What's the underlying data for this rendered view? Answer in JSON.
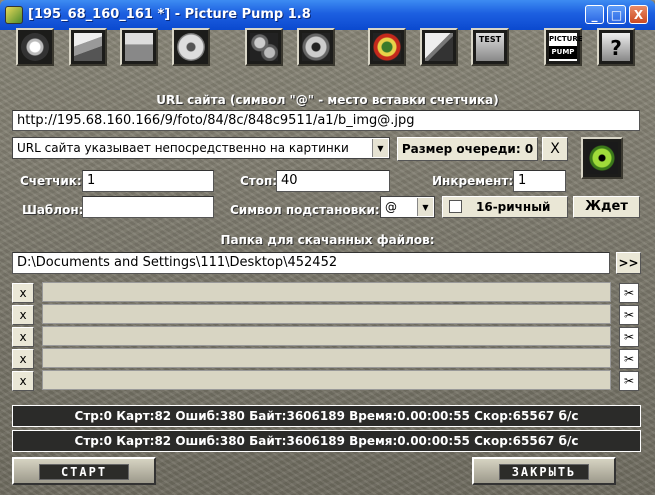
{
  "window": {
    "title": "[195_68_160_161 *] - Picture Pump 1.8"
  },
  "titlebar": {
    "minimize": "_",
    "maximize": "□",
    "close": "X"
  },
  "toolbar": {
    "test_label": "TEST",
    "picture_label": "PICTURE",
    "pump_label": "PUMP",
    "help_label": "?"
  },
  "url": {
    "label": "URL сайта (символ \"@\" - место вставки счетчика)",
    "value": "http://195.68.160.166/9/foto/84/8c/848c9511/a1/b_img@.jpg",
    "mode": "URL сайта указывает непосредственно на картинки",
    "queue_size": "Размер очереди: 0",
    "clear": "X"
  },
  "counter": {
    "counter_label": "Счетчик:",
    "counter_value": "1",
    "stop_label": "Стоп:",
    "stop_value": "40",
    "increment_label": "Инкремент:",
    "increment_value": "1",
    "template_label": "Шаблон:",
    "template_value": "",
    "symbol_label": "Символ подстановки:",
    "symbol_value": "@",
    "hex_label": "16-ричный",
    "wait_button": "Ждет"
  },
  "folder": {
    "label": "Папка для скачанных файлов:",
    "value": "D:\\Documents and Settings\\111\\Desktop\\452452",
    "browse": ">>"
  },
  "slots": [
    {
      "remove": "x",
      "action": "✂"
    },
    {
      "remove": "x",
      "action": "✂"
    },
    {
      "remove": "x",
      "action": "✂"
    },
    {
      "remove": "x",
      "action": "✂"
    },
    {
      "remove": "x",
      "action": "✂"
    }
  ],
  "status": [
    "Стр:0 Карт:82 Ошиб:380 Байт:3606189 Время:0.00:00:55 Скор:65567 б/с",
    "Стр:0 Карт:82 Ошиб:380 Байт:3606189 Время:0.00:00:55 Скор:65567 б/с"
  ],
  "buttons": {
    "start": "СТАРТ",
    "close": "ЗАКРЫТЬ"
  },
  "colors": {
    "titlebar": "#0b49cf",
    "background": "#7a776b",
    "status_bar": "#2b2b29"
  }
}
